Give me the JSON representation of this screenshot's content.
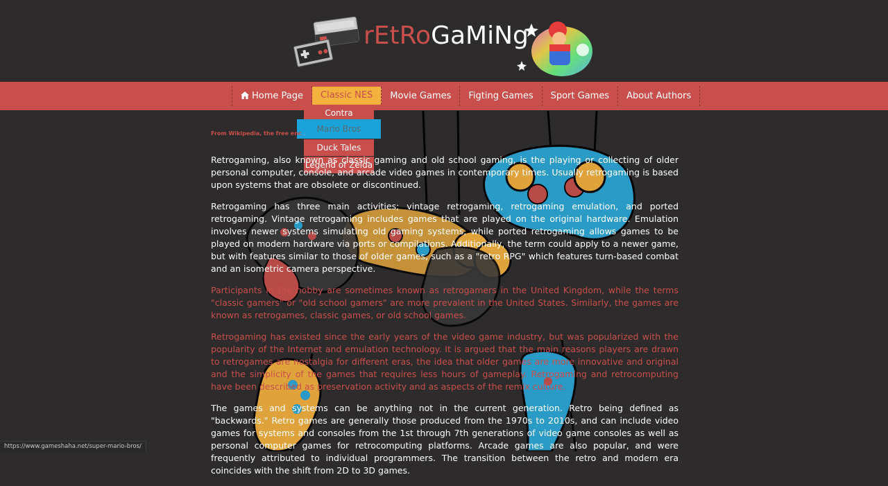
{
  "logo": {
    "part1": "rEtRo",
    "part2": "GaMiNg"
  },
  "nav": {
    "home": "Home Page",
    "classic": "Classic NES",
    "movie": "Movie Games",
    "fighting": "Figting Games",
    "sport": "Sport Games",
    "authors": "About Authors"
  },
  "dropdown": [
    "Contra",
    "Mario Bros",
    "Duck Tales",
    "Legend of Zelda"
  ],
  "content": {
    "source": "From Wikipedia, the free enc",
    "p1": "Retrogaming, also known as classic gaming and old school gaming, is the playing or collecting of older personal computer, console, and arcade video games in contemporary times. Usually retrogaming is based upon systems that are obsolete or discontinued.",
    "p2": "Retrogaming has three main activities; vintage retrogaming, retrogaming emulation, and ported retrogaming. Vintage retrogaming includes games that are played on the original hardware. Emulation involves newer systems simulating old gaming systems, while ported retrogaming allows games to be played on modern hardware via ports or compilations. Additionally, the term could apply to a newer game, but with features similar to those of older games, such as a \"retro RPG\" which features turn-based combat and an isometric camera perspective.",
    "p3": "Participants in the hobby are sometimes known as retrogamers in the United Kingdom, while the terms \"classic gamers\" or \"old school gamers\" are more prevalent in the United States. Similarly, the games are known as retrogames, classic games, or old school games.",
    "p4": "Retrogaming has existed since the early years of the video game industry, but was popularized with the popularity of the Internet and emulation technology. It is argued that the main reasons players are drawn to retrogames are nostalgia for different eras, the idea that older games are more innovative and original and the simplicity of the games that requires less hours of gameplay. Retrogaming and retrocomputing have been described as preservation activity and as aspects of the remix culture.",
    "p5": "The games and systems can be anything not in the current generation. Retro being defined as \"backwards.\" Retro games are generally those produced from the 1970s to 2010s, and can include video games for systems and consoles from the 1st through 7th generations of video game consoles as well as personal computer games for retrocomputing platforms. Arcade games are also popular, and were frequently attributed to individual programmers. The transition between the retro and modern era coincides with the shift from 2D to 3D games."
  },
  "status_url": "https://www.gameshaha.net/super-mario-bros/",
  "colors": {
    "background": "#2d2b2c",
    "accent_red": "#c84f4c",
    "active_yellow": "#f4b13e",
    "hover_blue": "#19a3d8"
  }
}
